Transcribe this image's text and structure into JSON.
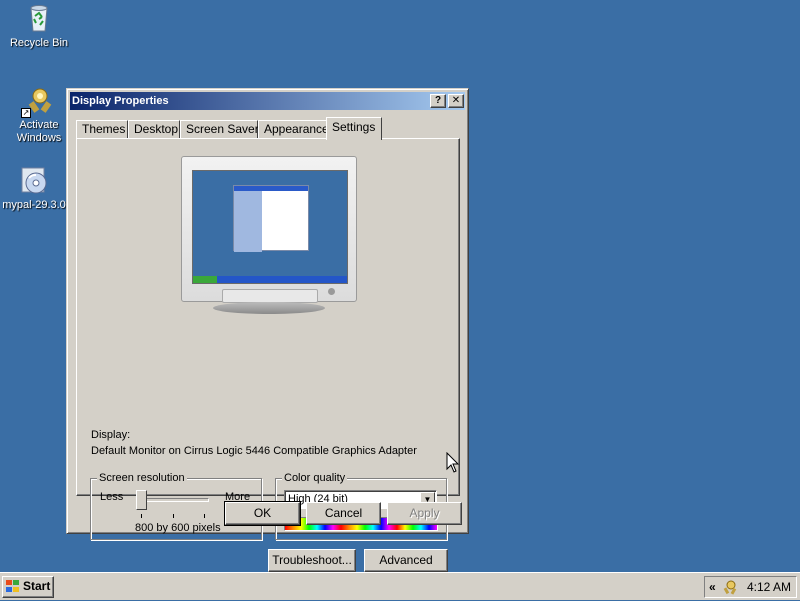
{
  "desktop": {
    "icons": [
      {
        "label": "Recycle Bin",
        "icon": "recycle-bin-icon"
      },
      {
        "label": "Activate Windows",
        "icon": "activate-windows-icon"
      },
      {
        "label": "mypal-29.3.0",
        "icon": "installer-cd-icon"
      }
    ]
  },
  "dialog": {
    "title": "Display Properties",
    "help_btn": "?",
    "close_btn": "✕",
    "tabs": [
      "Themes",
      "Desktop",
      "Screen Saver",
      "Appearance",
      "Settings"
    ],
    "active_tab": "Settings",
    "display_label": "Display:",
    "display_value": "Default Monitor on Cirrus Logic 5446 Compatible Graphics Adapter",
    "screen_resolution": {
      "legend": "Screen resolution",
      "less": "Less",
      "more": "More",
      "value_text": "800 by 600 pixels",
      "slider_level": 0
    },
    "color_quality": {
      "legend": "Color quality",
      "selected": "High (24 bit)"
    },
    "buttons": {
      "troubleshoot": "Troubleshoot...",
      "advanced": "Advanced",
      "ok": "OK",
      "cancel": "Cancel",
      "apply": "Apply"
    }
  },
  "taskbar": {
    "start_label": "Start",
    "tray_expand": "«",
    "clock": "4:12 AM"
  },
  "colors": {
    "desktop": "#3a6ea5",
    "face": "#d4d0c8",
    "title_start": "#0a246a",
    "title_end": "#a6caf0"
  }
}
